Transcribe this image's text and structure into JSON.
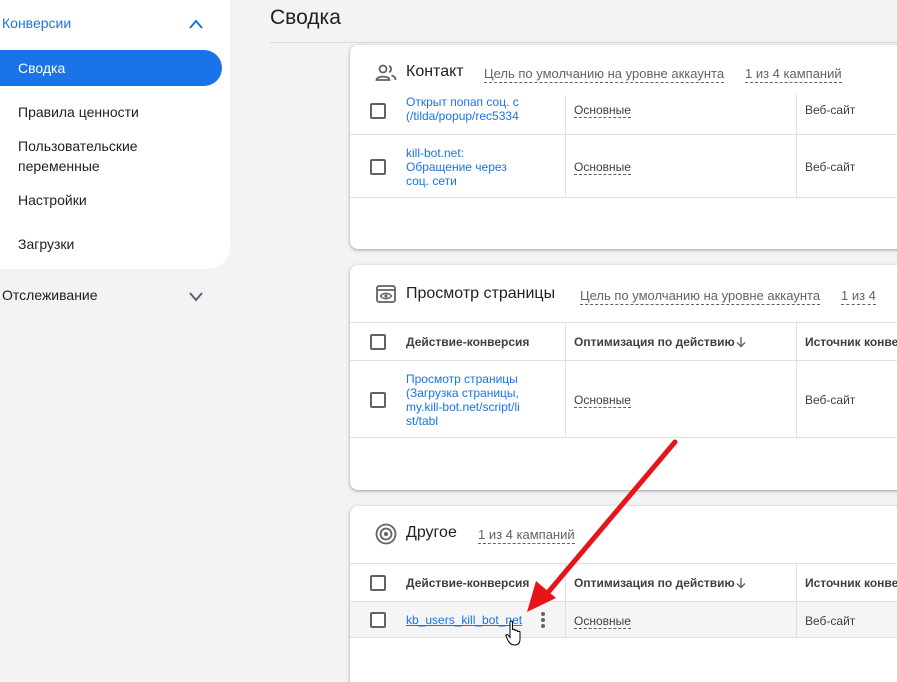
{
  "sidebar": {
    "section": "Конверсии",
    "active_item": "Сводка",
    "items": [
      "Правила ценности",
      "Пользовательские\nпеременные",
      "Настройки",
      "Загрузки"
    ],
    "tracking": "Отслеживание"
  },
  "header": {
    "title": "Сводка"
  },
  "cards": {
    "contact": {
      "title": "Контакт",
      "goal_default": "Цель по умолчанию на уровне аккаунта",
      "campaigns": "1 из 4 кампаний",
      "rows": [
        {
          "name": "Открыт попап соц. с (/tilda/popup/rec5334",
          "optimization": "Основные",
          "source": "Веб-сайт"
        },
        {
          "name": "kill-bot.net: Обращение через соц. сети",
          "optimization": "Основные",
          "source": "Веб-сайт"
        }
      ]
    },
    "pageview": {
      "title": "Просмотр страницы",
      "goal_default": "Цель по умолчанию на уровне аккаунта",
      "campaigns": "1 из 4",
      "columns": {
        "action": "Действие-конверсия",
        "optimization": "Оптимизация по действию",
        "source": "Источник конве"
      },
      "rows": [
        {
          "name": "Просмотр страницы (Загрузка страницы, my.kill-bot.net/script/list/tabl",
          "optimization": "Основные",
          "source": "Веб-сайт"
        }
      ]
    },
    "other": {
      "title": "Другое",
      "campaigns": "1 из 4 кампаний",
      "columns": {
        "action": "Действие-конверсия",
        "optimization": "Оптимизация по действию",
        "source": "Источник конве"
      },
      "rows": [
        {
          "name": "kb_users_kill_bot_net",
          "optimization": "Основные",
          "source": "Веб-сайт"
        }
      ]
    }
  },
  "colors": {
    "accent": "#1a73e8",
    "arrow": "#e8141c"
  },
  "icons": {
    "contact": "people-icon",
    "pageview": "eye-window-icon",
    "other": "target-icon"
  }
}
